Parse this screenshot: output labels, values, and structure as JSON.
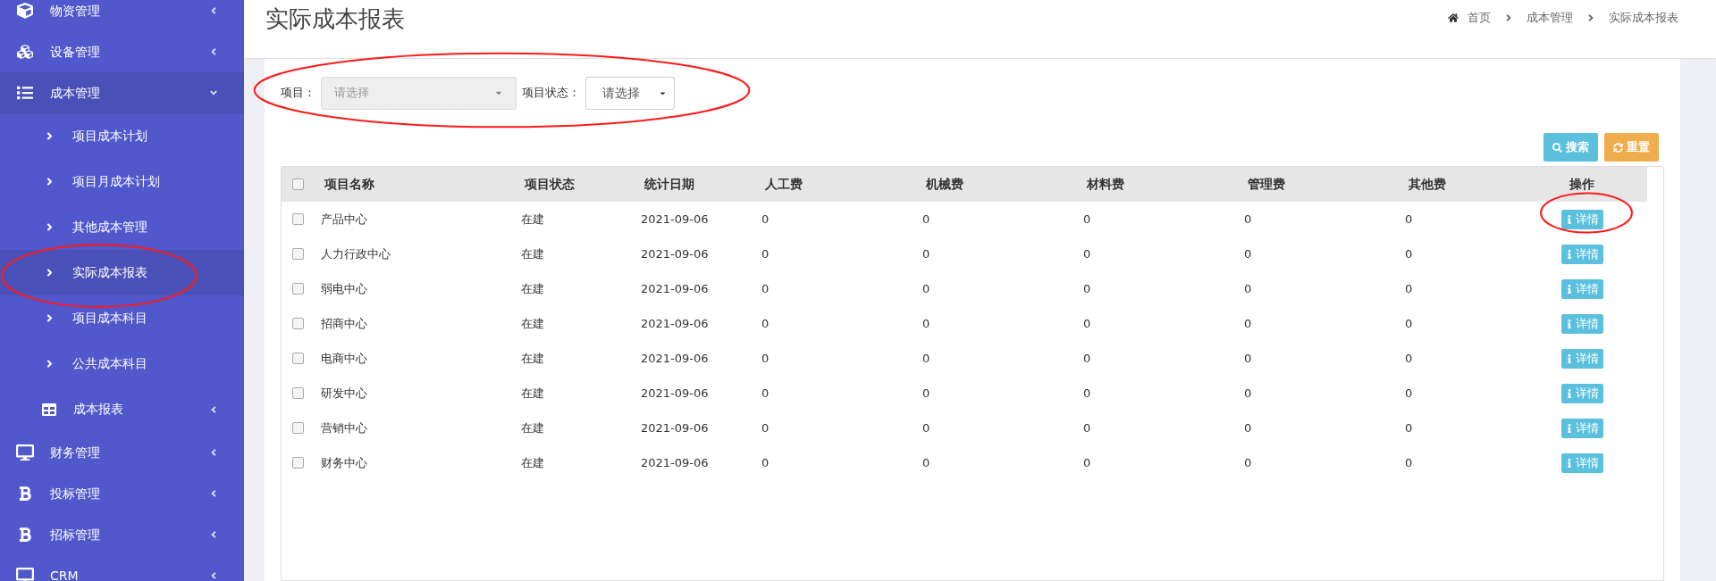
{
  "sidebar": {
    "items": [
      {
        "label": "物资管理",
        "kind": "cube",
        "expanded": false
      },
      {
        "label": "设备管理",
        "kind": "cubes",
        "expanded": false
      },
      {
        "label": "成本管理",
        "kind": "list",
        "expanded": true,
        "children": [
          {
            "label": "项目成本计划",
            "kind": "link",
            "selected": false
          },
          {
            "label": "项目月成本计划",
            "kind": "link",
            "selected": false
          },
          {
            "label": "其他成本管理",
            "kind": "link",
            "selected": false
          },
          {
            "label": "实际成本报表",
            "kind": "link",
            "selected": true
          },
          {
            "label": "项目成本科目",
            "kind": "link",
            "selected": false
          },
          {
            "label": "公共成本科目",
            "kind": "link",
            "selected": false
          },
          {
            "label": "成本报表",
            "kind": "table",
            "expanded": false,
            "selected": false
          }
        ]
      },
      {
        "label": "财务管理",
        "kind": "desktop",
        "expanded": false
      },
      {
        "label": "投标管理",
        "kind": "bold",
        "expanded": false
      },
      {
        "label": "招标管理",
        "kind": "bold",
        "expanded": false
      },
      {
        "label": "CRM",
        "kind": "desktop",
        "expanded": false
      }
    ]
  },
  "page": {
    "title": "实际成本报表",
    "breadcrumb": [
      "首页",
      "成本管理",
      "实际成本报表"
    ]
  },
  "filters": [
    {
      "kind": "combo",
      "label": "项目：",
      "placeholder": "请选择"
    },
    {
      "kind": "select",
      "label": "项目状态：",
      "value": "请选择"
    }
  ],
  "buttons": [
    {
      "label": "搜索",
      "kind": "search",
      "color": "#5bc0de"
    },
    {
      "label": "重置",
      "kind": "reset",
      "color": "#f0ad4e"
    }
  ],
  "table": {
    "header_checked": false,
    "columns": [
      "项目名称",
      "项目状态",
      "统计日期",
      "人工费",
      "机械费",
      "材料费",
      "管理费",
      "其他费",
      "操作"
    ],
    "rows": [
      {
        "checked": false,
        "cells": [
          "产品中心",
          "在建",
          "2021-09-06",
          "0",
          "0",
          "0",
          "0",
          "0"
        ],
        "action": "详情"
      },
      {
        "checked": false,
        "cells": [
          "人力行政中心",
          "在建",
          "2021-09-06",
          "0",
          "0",
          "0",
          "0",
          "0"
        ],
        "action": "详情"
      },
      {
        "checked": false,
        "cells": [
          "弱电中心",
          "在建",
          "2021-09-06",
          "0",
          "0",
          "0",
          "0",
          "0"
        ],
        "action": "详情"
      },
      {
        "checked": false,
        "cells": [
          "招商中心",
          "在建",
          "2021-09-06",
          "0",
          "0",
          "0",
          "0",
          "0"
        ],
        "action": "详情"
      },
      {
        "checked": false,
        "cells": [
          "电商中心",
          "在建",
          "2021-09-06",
          "0",
          "0",
          "0",
          "0",
          "0"
        ],
        "action": "详情"
      },
      {
        "checked": false,
        "cells": [
          "研发中心",
          "在建",
          "2021-09-06",
          "0",
          "0",
          "0",
          "0",
          "0"
        ],
        "action": "详情"
      },
      {
        "checked": false,
        "cells": [
          "营销中心",
          "在建",
          "2021-09-06",
          "0",
          "0",
          "0",
          "0",
          "0"
        ],
        "action": "详情"
      },
      {
        "checked": false,
        "cells": [
          "财务中心",
          "在建",
          "2021-09-06",
          "0",
          "0",
          "0",
          "0",
          "0"
        ],
        "action": "详情"
      }
    ]
  }
}
